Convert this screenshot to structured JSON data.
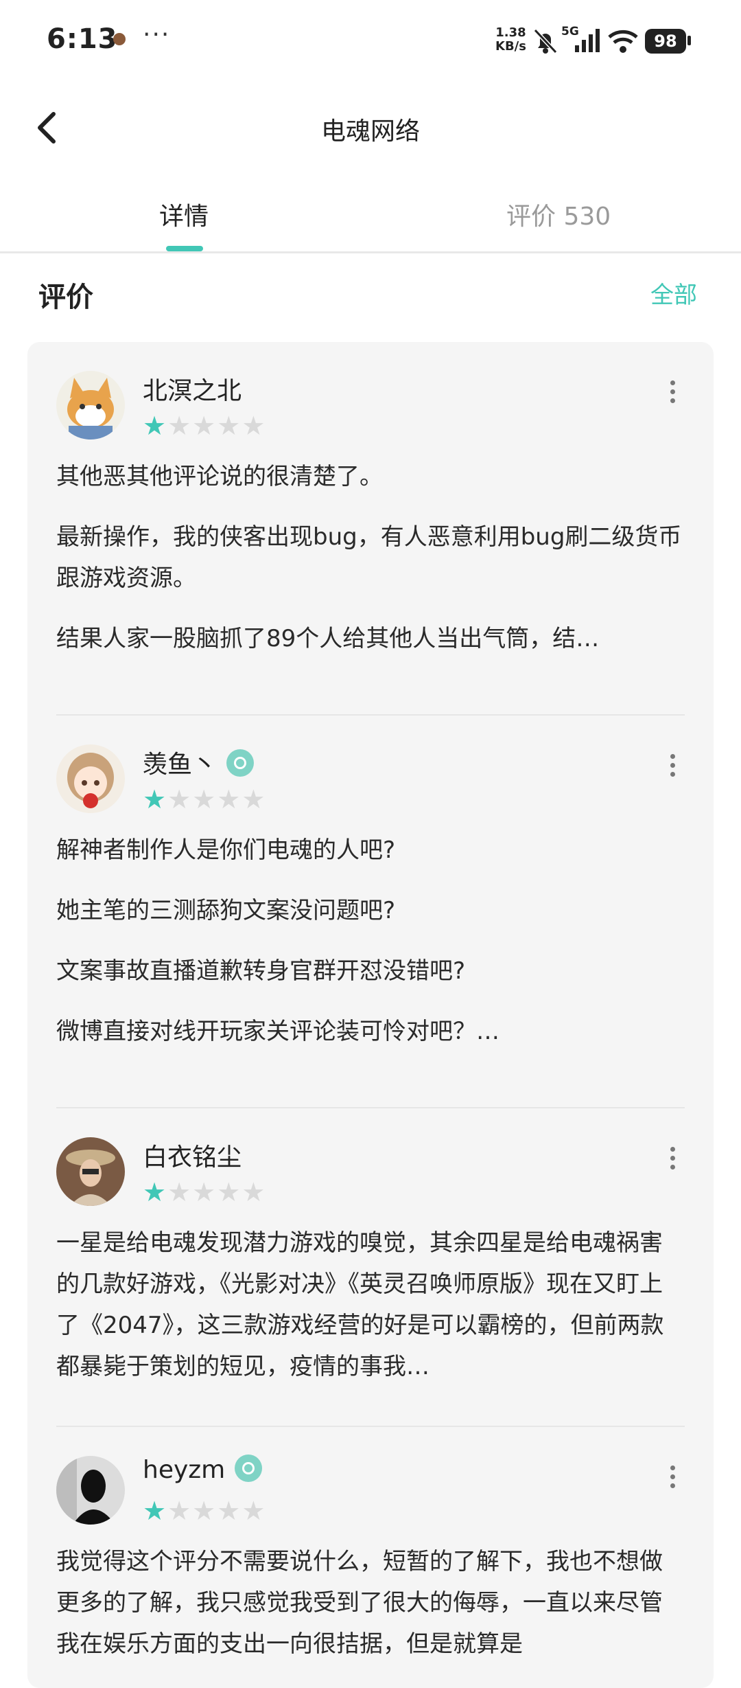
{
  "status_bar": {
    "time": "6:13",
    "more": "···",
    "net_speed_value": "1.38",
    "net_speed_unit": "KB/s",
    "signal_label": "5G",
    "battery": "98"
  },
  "header": {
    "title": "电魂网络"
  },
  "tabs": [
    {
      "label": "详情",
      "active": true
    },
    {
      "label": "评价 530",
      "active": false
    }
  ],
  "section": {
    "title": "评价",
    "view_all": "全部"
  },
  "accent_color": "#41c7b6",
  "reviews": [
    {
      "username": "北溟之北",
      "rating": 1,
      "verified_badge": false,
      "paragraphs": [
        "其他恶其他评论说的很清楚了。",
        "最新操作，我的侠客出现bug，有人恶意利用bug刷二级货币跟游戏资源。",
        "结果人家一股脑抓了89个人给其他人当出气筒，结…"
      ]
    },
    {
      "username": "羡鱼丶",
      "rating": 1,
      "verified_badge": true,
      "paragraphs": [
        "解神者制作人是你们电魂的人吧?",
        "她主笔的三测舔狗文案没问题吧?",
        "文案事故直播道歉转身官群开怼没错吧?",
        "微博直接对线开玩家关评论装可怜对吧？…"
      ]
    },
    {
      "username": "白衣铭尘",
      "rating": 1,
      "verified_badge": false,
      "paragraphs": [
        "一星是给电魂发现潜力游戏的嗅觉，其余四星是给电魂祸害的几款好游戏，《光影对决》《英灵召唤师原版》现在又盯上了《2047》，这三款游戏经营的好是可以霸榜的，但前两款都暴毙于策划的短见，疫情的事我…"
      ]
    },
    {
      "username": "heyzm",
      "rating": 1,
      "verified_badge": true,
      "paragraphs": [
        "我觉得这个评分不需要说什么，短暂的了解下，我也不想做更多的了解，我只感觉我受到了很大的侮辱，一直以来尽管我在娱乐方面的支出一向很拮据，但是就算是"
      ]
    }
  ]
}
